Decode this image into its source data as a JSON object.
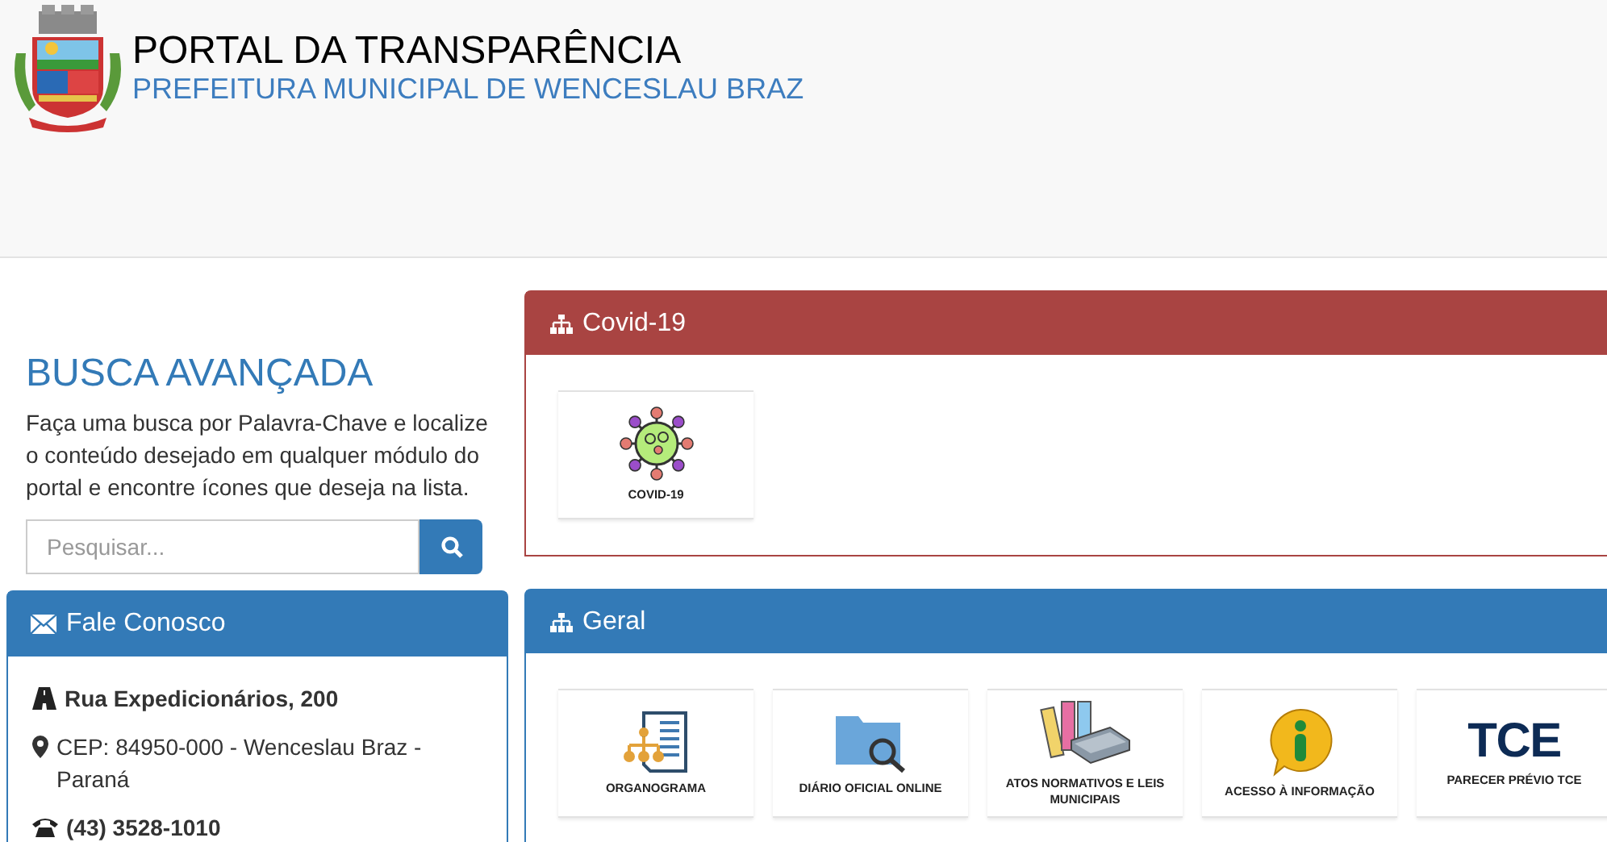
{
  "header": {
    "title": "PORTAL DA TRANSPARÊNCIA",
    "subtitle": "PREFEITURA MUNICIPAL DE WENCESLAU BRAZ"
  },
  "search": {
    "heading": "BUSCA AVANÇADA",
    "description": "Faça uma busca por Palavra-Chave e localize o conteúdo desejado em qualquer módulo do portal e encontre ícones que deseja na lista.",
    "placeholder": "Pesquisar..."
  },
  "contact": {
    "title": "Fale Conosco",
    "items": [
      {
        "kind": "address",
        "text": "Rua Expedicionários, 200"
      },
      {
        "kind": "location",
        "text": "CEP: 84950-000 - Wenceslau Braz - Paraná"
      },
      {
        "kind": "phone",
        "text": "(43) 3528-1010"
      }
    ]
  },
  "panels": [
    {
      "title": "Covid-19",
      "color": "#a94442",
      "tiles": [
        {
          "kind": "virus",
          "label": "COVID-19"
        }
      ]
    },
    {
      "title": "Geral",
      "color": "#337ab7",
      "tiles": [
        {
          "kind": "org",
          "label": "ORGANOGRAMA"
        },
        {
          "kind": "folder",
          "label": "DIÁRIO OFICIAL ONLINE"
        },
        {
          "kind": "binders",
          "label": "ATOS NORMATIVOS E LEIS MUNICIPAIS"
        },
        {
          "kind": "info",
          "label": "ACESSO À INFORMAÇÃO"
        },
        {
          "kind": "logo",
          "logo_text": "TCE",
          "label": "PARECER PRÉVIO TCE"
        }
      ]
    }
  ]
}
